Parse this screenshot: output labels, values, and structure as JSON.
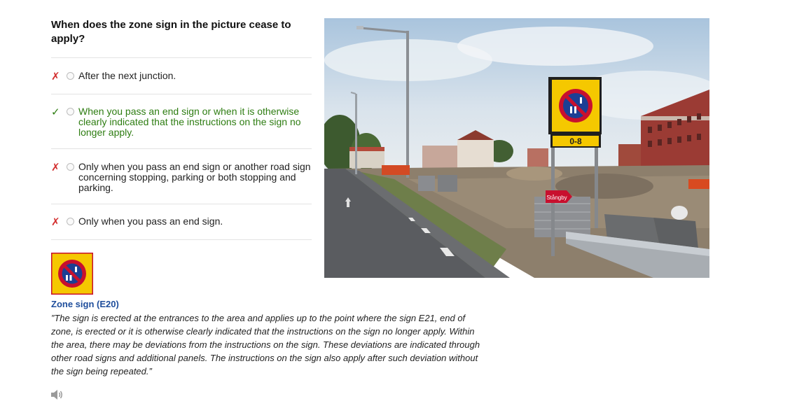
{
  "question": {
    "text": "When does the zone sign in the picture cease to apply?"
  },
  "answers": [
    {
      "text": "After the next junction.",
      "result": "wrong"
    },
    {
      "text": "When you pass an end sign or when it is otherwise clearly indicated that the instructions on the sign no longer apply.",
      "result": "correct"
    },
    {
      "text": "Only when you pass an end sign or another road sign concerning stopping, parking or both stopping and parking.",
      "result": "wrong"
    },
    {
      "text": "Only when you pass an end sign.",
      "result": "wrong"
    }
  ],
  "marks": {
    "wrong": "✗",
    "correct": "✓"
  },
  "photo": {
    "sign_plate": "0-8",
    "arrow_sign": "Stångby"
  },
  "explanation": {
    "sign_title": "Zone sign (E20)",
    "text": "”The sign is erected at the entrances to the area and applies up to the point where the sign E21, end of zone, is erected or it is otherwise clearly indicated that the instructions on the sign no longer apply. Within the area, there may be deviations from the instructions on the sign. These deviations are indicated through other road signs and additional panels. The instructions on the sign also apply after such deviation without the sign being repeated.”"
  },
  "icons": {
    "speaker": "speaker-icon",
    "sign": "zone-sign-e20-icon"
  },
  "colors": {
    "correct": "#2e7d12",
    "wrong": "#d32f2f",
    "title_link": "#1f4e9c",
    "sign_yellow": "#f5c800",
    "sign_red": "#c8102e",
    "sign_blue": "#1c3f94"
  }
}
